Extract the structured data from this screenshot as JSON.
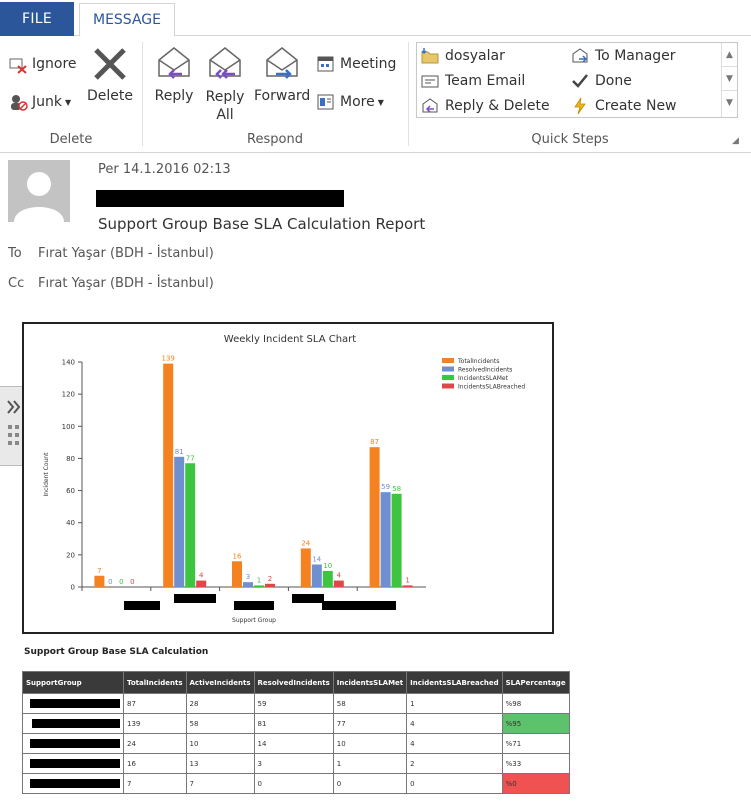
{
  "ribbon": {
    "tabs": {
      "file": "FILE",
      "message": "MESSAGE"
    },
    "delete_group": {
      "ignore": "Ignore",
      "junk": "Junk",
      "delete": "Delete",
      "label": "Delete"
    },
    "respond_group": {
      "reply": "Reply",
      "reply_all_1": "Reply",
      "reply_all_2": "All",
      "forward": "Forward",
      "meeting": "Meeting",
      "more": "More",
      "label": "Respond"
    },
    "quick_steps": {
      "label": "Quick Steps",
      "items": [
        "dosyalar",
        "To Manager",
        "Team Email",
        "Done",
        "Reply & Delete",
        "Create New"
      ]
    }
  },
  "message": {
    "date": "Per 14.1.2016 02:13",
    "subject": "Support Group Base SLA Calculation Report",
    "to_label": "To",
    "to_value": "Fırat Yaşar (BDH - İstanbul)",
    "cc_label": "Cc",
    "cc_value": "Fırat Yaşar (BDH - İstanbul)"
  },
  "chart_data": {
    "type": "bar",
    "title": "Weekly Incident SLA Chart",
    "xlabel": "Support Group",
    "ylabel": "Incident Count",
    "ylim": [
      0,
      140
    ],
    "yticks": [
      0,
      20,
      40,
      60,
      80,
      100,
      120,
      140
    ],
    "categories": [
      "",
      "",
      "",
      "",
      ""
    ],
    "series": [
      {
        "name": "TotalIncidents",
        "color": "#f58220",
        "values": [
          7,
          139,
          16,
          24,
          87
        ]
      },
      {
        "name": "ResolvedIncidents",
        "color": "#6f8fd0",
        "values": [
          0,
          81,
          3,
          14,
          59
        ]
      },
      {
        "name": "IncidentsSLAMet",
        "color": "#3fc43f",
        "values": [
          0,
          77,
          1,
          10,
          58
        ]
      },
      {
        "name": "IncidentsSLABreached",
        "color": "#e04848",
        "values": [
          0,
          4,
          2,
          4,
          1
        ]
      }
    ],
    "legend": "top-right"
  },
  "table": {
    "title": "Support Group Base SLA Calculation",
    "headers": [
      "SupportGroup",
      "TotalIncidents",
      "ActiveIncidents",
      "ResolvedIncidents",
      "IncidentsSLAMet",
      "IncidentsSLABreached",
      "SLAPercentage"
    ],
    "rows": [
      [
        "",
        "87",
        "28",
        "59",
        "58",
        "1",
        "%98"
      ],
      [
        "",
        "139",
        "58",
        "81",
        "77",
        "4",
        "%95"
      ],
      [
        "",
        "24",
        "10",
        "14",
        "10",
        "4",
        "%71"
      ],
      [
        "",
        "16",
        "13",
        "3",
        "1",
        "2",
        "%33"
      ],
      [
        "",
        "7",
        "7",
        "0",
        "0",
        "0",
        "%0"
      ]
    ],
    "highlight_colors": {
      "good": "#5cc26b",
      "bad": "#f05252"
    }
  }
}
